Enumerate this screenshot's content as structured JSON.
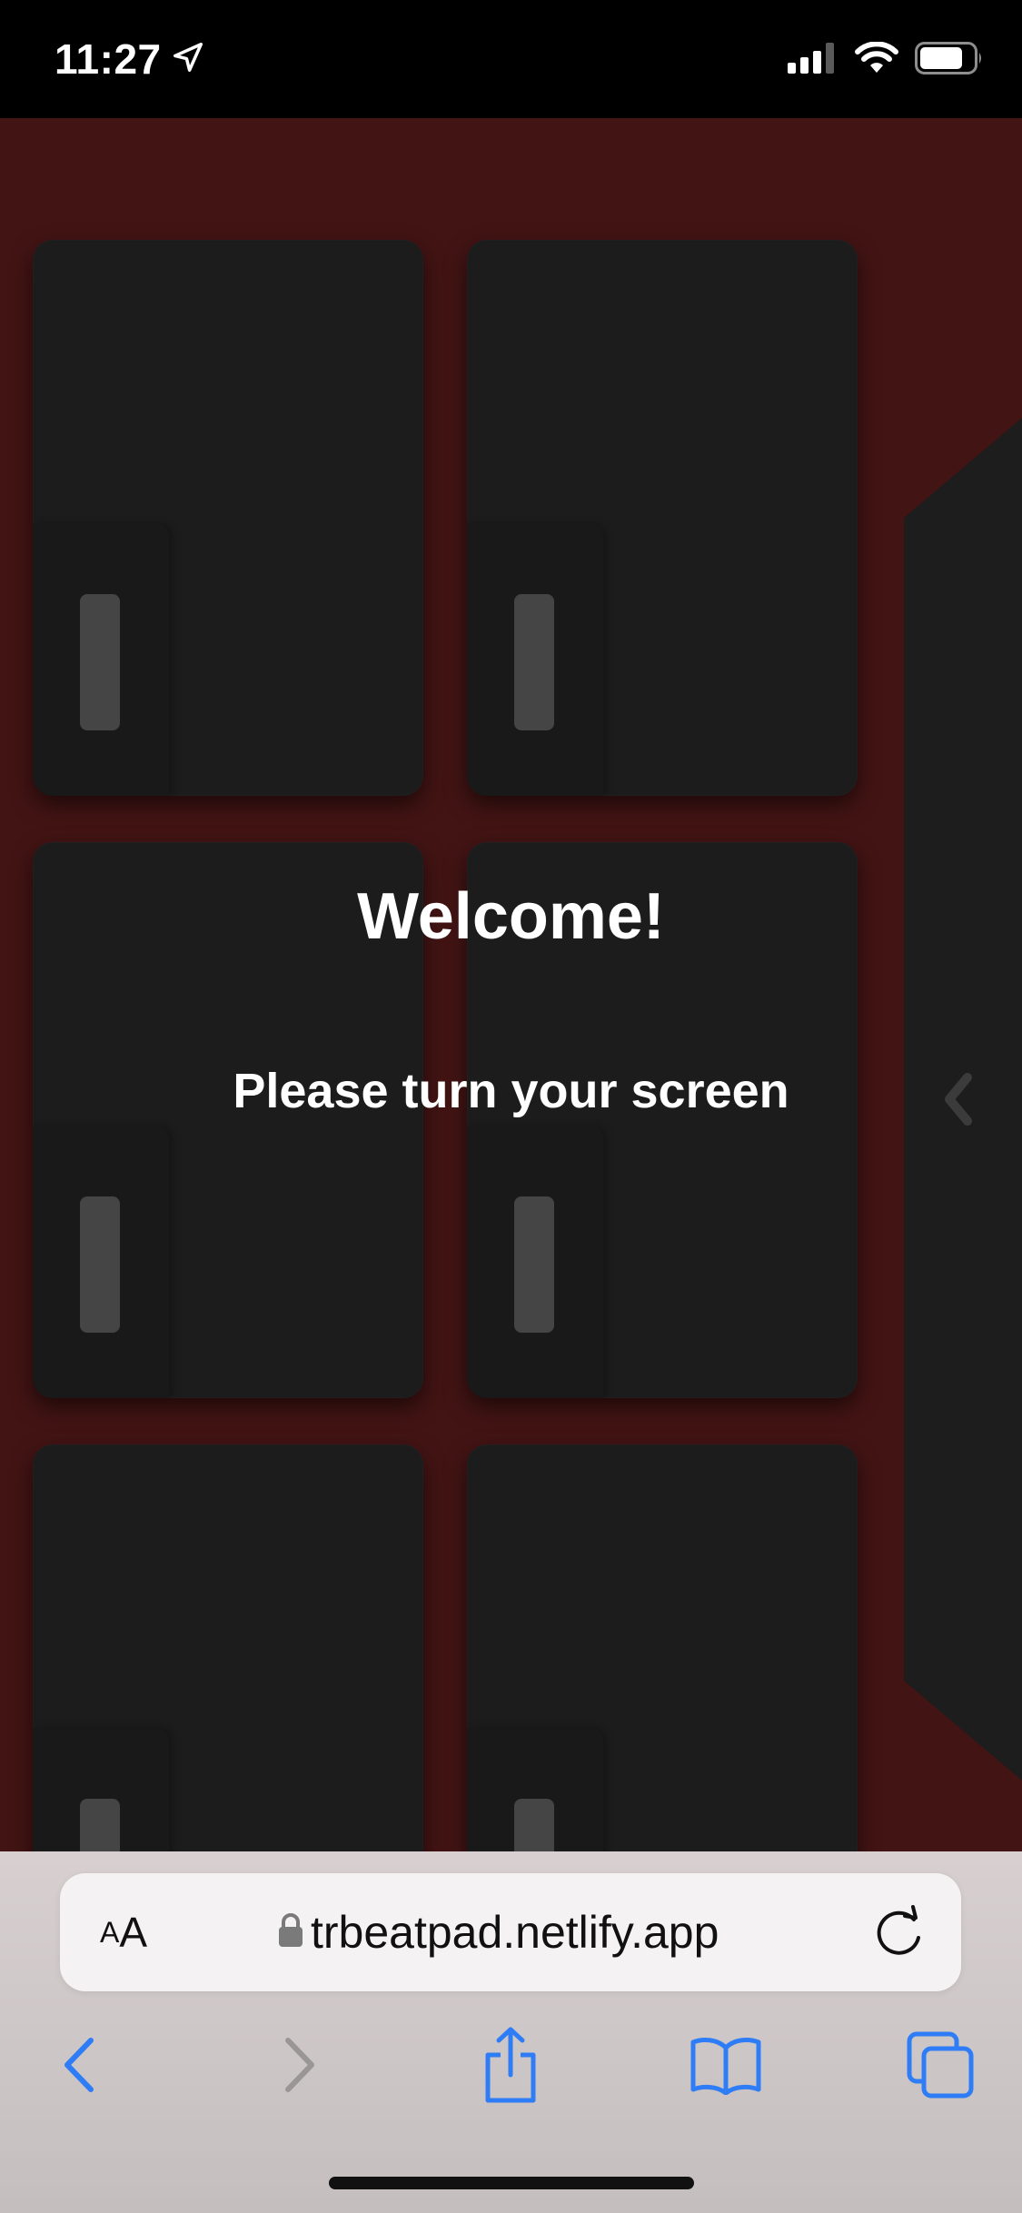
{
  "status_bar": {
    "time": "11:27",
    "icons": [
      "location-arrow-icon",
      "cellular-signal-icon",
      "wifi-icon",
      "battery-icon"
    ]
  },
  "page": {
    "background_color": "#431414",
    "pad_color": "#1c1c1c",
    "welcome_title": "Welcome!",
    "rotate_message": "Please turn your screen",
    "side_panel_icon": "chevron-left-icon"
  },
  "browser": {
    "text_size_small": "A",
    "text_size_large": "A",
    "url": "trbeatpad.netlify.app",
    "url_icon": "lock-icon",
    "accent_color": "#2f7df6",
    "toolbar": [
      "back-icon",
      "forward-icon",
      "share-icon",
      "bookmarks-icon",
      "tabs-icon"
    ]
  }
}
